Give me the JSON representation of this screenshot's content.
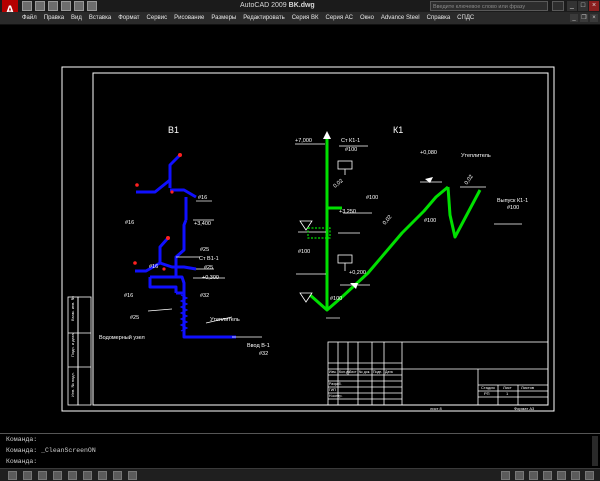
{
  "titlebar": {
    "app": "AutoCAD 2009",
    "file": "BK.dwg",
    "search_placeholder": "Введите ключевое слово или фразу"
  },
  "menubar": {
    "items": [
      "Файл",
      "Правка",
      "Вид",
      "Вставка",
      "Формат",
      "Сервис",
      "Рисование",
      "Размеры",
      "Редактировать",
      "Серия ВК",
      "Серия АС",
      "Окно",
      "Advance Steel",
      "Справка",
      "СПДС"
    ]
  },
  "drawing": {
    "left_title": "В1",
    "right_title": "К1",
    "left_labels": {
      "d16_a": "#16",
      "d16_b": "#16",
      "d16_c": "#16",
      "d16_d": "#16",
      "elev_3400": "+3,400",
      "d25_a": "#25",
      "riser": "Ст В1-1",
      "d25_b": "#25",
      "elev_0300": "+0,300",
      "d32_a": "#32",
      "d25_c": "#25",
      "meter": "Водомерный узел",
      "insulation": "Утеплитель",
      "inlet": "Ввод В-1",
      "d32_b": "#32"
    },
    "right_labels": {
      "elev_7000": "+7,000",
      "riser": "Ст К1-1",
      "d100_a": "#100",
      "slope_002_a": "0,02",
      "d100_b": "#100",
      "elev_3250": "+3,250",
      "d100_c": "#100",
      "slope_002_b": "0,02",
      "d100_d": "#100",
      "elev_0200": "+0,200",
      "d100_e": "#100",
      "elev_0080": "+0,080",
      "insulation": "Утеплитель",
      "slope_002_c": "0,02",
      "outlet": "Выпуск К1-1",
      "d100_f": "#100"
    },
    "stamp": {
      "stage": "Стадия",
      "sheet": "Лист",
      "sheets": "Листов",
      "stage_val": "РП",
      "sheet_val": "1",
      "rows": [
        "Изм.",
        "Кол.уч.",
        "Лист",
        "№ док.",
        "Подп.",
        "Дата"
      ],
      "developed": "Разраб.",
      "checked": "ГИП",
      "norm": "Н.контр.",
      "format_label": "Формат А3",
      "copy_label": "лист 8"
    },
    "side_stamp": [
      "Инв. № подл.",
      "Подп. и дата",
      "Взам. инв. №"
    ]
  },
  "cmdline": {
    "lines": [
      {
        "prompt": "Команда:",
        "value": ""
      },
      {
        "prompt": "Команда:",
        "value": "_CleanScreenON"
      },
      {
        "prompt": "Команда:",
        "value": ""
      }
    ]
  },
  "colors": {
    "water_pipe": "#1010ff",
    "sewer_pipe": "#00e000",
    "text": "#ffffff",
    "magenta": "#ff40ff",
    "frame": "#ffffff"
  }
}
